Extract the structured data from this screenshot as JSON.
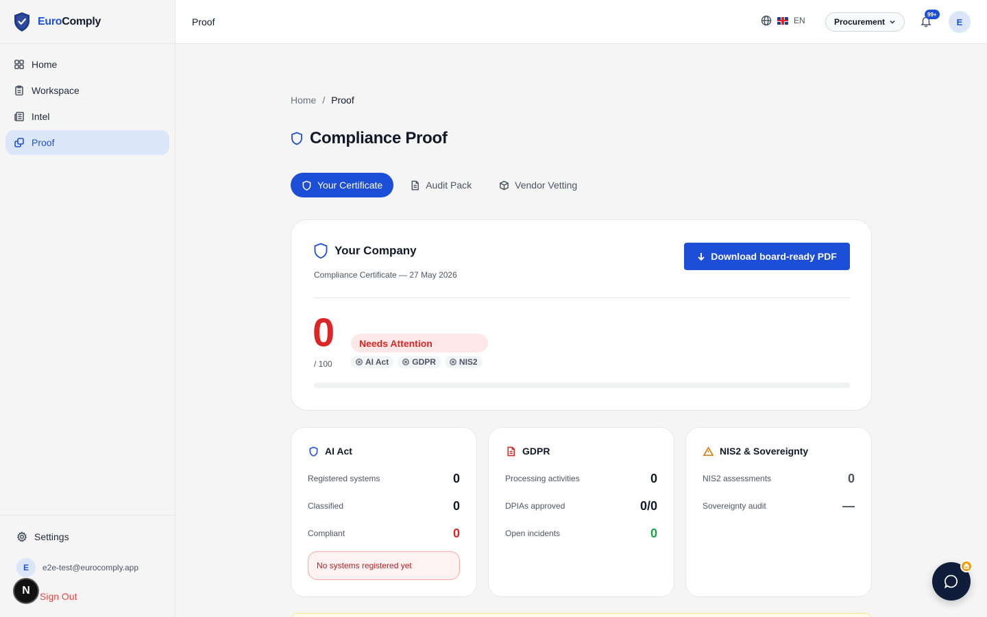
{
  "app": {
    "brand_part1": "Euro",
    "brand_part2": "Comply",
    "accent_color": "#1d4ed8"
  },
  "sidebar": {
    "items": [
      {
        "label": "Home",
        "icon": "grid-icon"
      },
      {
        "label": "Workspace",
        "icon": "clipboard-icon"
      },
      {
        "label": "Intel",
        "icon": "newspaper-icon"
      },
      {
        "label": "Proof",
        "icon": "proof-icon",
        "active": true
      }
    ],
    "settings_label": "Settings",
    "user_initial": "E",
    "user_email": "e2e-test@eurocomply.app",
    "signout_label": "Sign Out",
    "dev_badge": "N"
  },
  "topbar": {
    "title": "Proof",
    "language": "EN",
    "role": "Procurement",
    "notification_count": "99+",
    "avatar_initial": "E"
  },
  "breadcrumb": {
    "home": "Home",
    "separator": "/",
    "current": "Proof"
  },
  "page": {
    "title": "Compliance Proof"
  },
  "tabs": [
    {
      "label": "Your Certificate",
      "icon": "shield-icon",
      "active": true
    },
    {
      "label": "Audit Pack",
      "icon": "document-icon"
    },
    {
      "label": "Vendor Vetting",
      "icon": "box-icon"
    }
  ],
  "certificate": {
    "company": "Your Company",
    "subtitle": "Compliance Certificate — 27 May 2026",
    "download_label": "Download board-ready PDF",
    "score": "0",
    "score_max": "/ 100",
    "score_fraction": 0,
    "status": "Needs Attention",
    "frameworks": [
      "AI Act",
      "GDPR",
      "NIS2"
    ]
  },
  "cards": {
    "ai_act": {
      "title": "AI Act",
      "rows": [
        {
          "label": "Registered systems",
          "value": "0"
        },
        {
          "label": "Classified",
          "value": "0"
        },
        {
          "label": "Compliant",
          "value": "0"
        }
      ],
      "alert": "No systems registered yet"
    },
    "gdpr": {
      "title": "GDPR",
      "rows": [
        {
          "label": "Processing activities",
          "value": "0"
        },
        {
          "label": "DPIAs approved",
          "value": "0/0"
        },
        {
          "label": "Open incidents",
          "value": "0"
        }
      ]
    },
    "nis2": {
      "title": "NIS2 & Sovereignty",
      "rows": [
        {
          "label": "NIS2 assessments",
          "value": "0"
        },
        {
          "label": "Sovereignty audit",
          "value": "—"
        }
      ]
    }
  }
}
